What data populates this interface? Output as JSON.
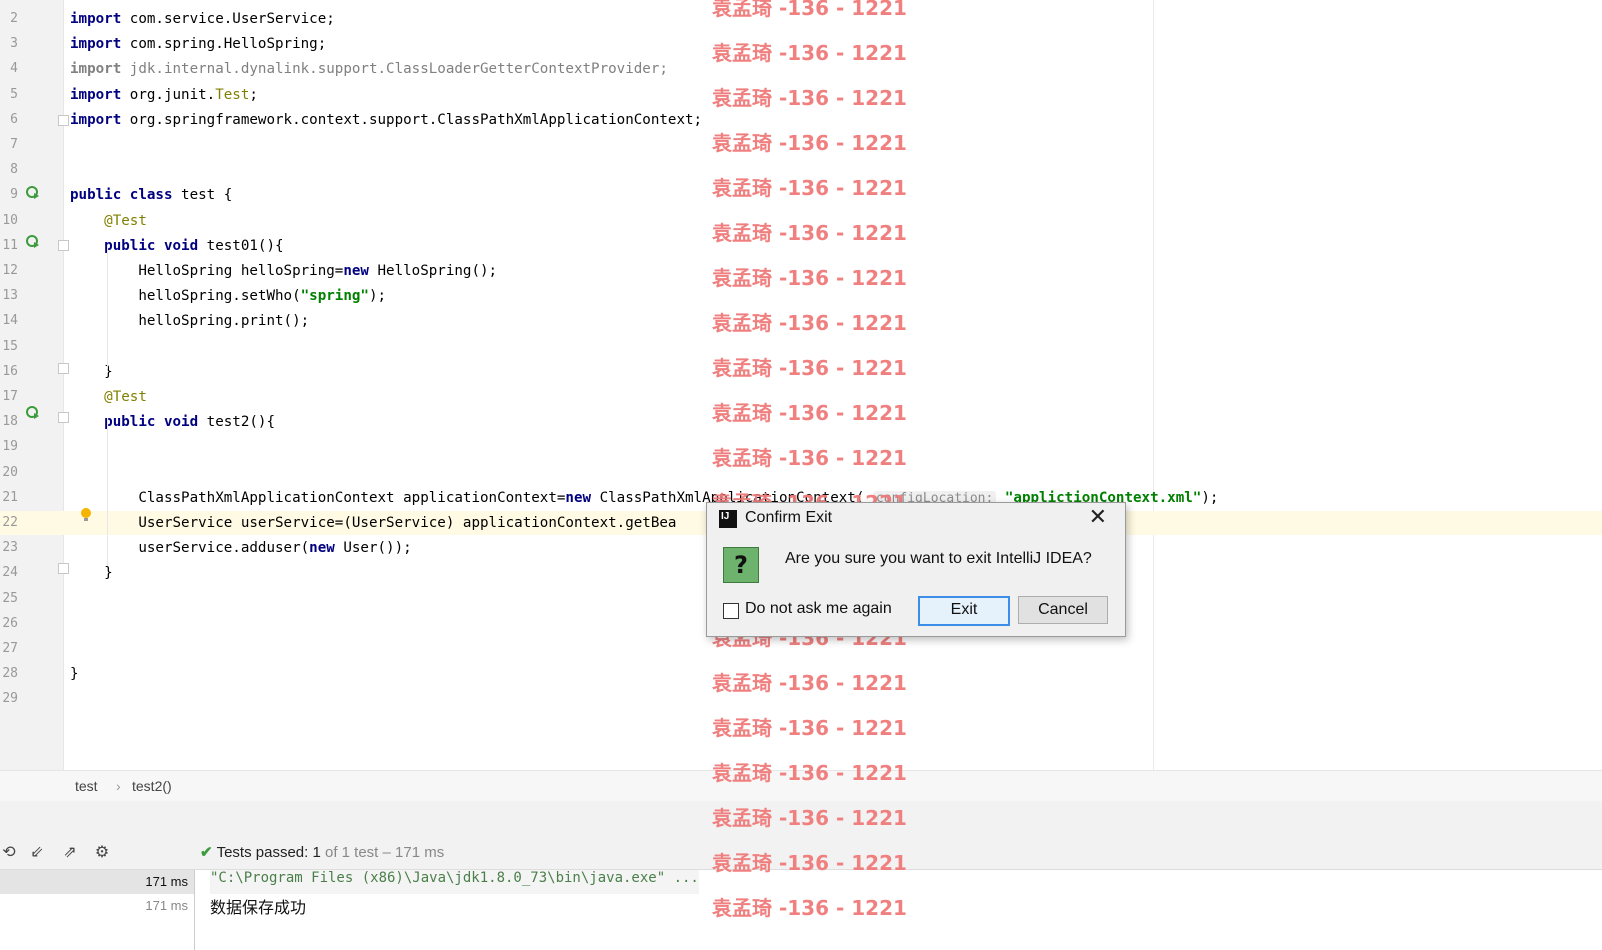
{
  "editor": {
    "lines": [
      {
        "num": "2",
        "html": "<span class=\"kw\">import</span> com.service.UserService;"
      },
      {
        "num": "3",
        "html": "<span class=\"kw\">import</span> com.spring.HelloSpring;"
      },
      {
        "num": "4",
        "html": "<span class=\"kw gray\">import</span> <span class=\"gray\">jdk.internal.dynalink.support.ClassLoaderGetterContextProvider;</span>"
      },
      {
        "num": "5",
        "html": "<span class=\"kw\">import</span> org.junit.<span class=\"ann\">Test</span>;"
      },
      {
        "num": "6",
        "html": "<span class=\"kw\">import</span> org.springframework.context.support.ClassPathXmlApplicationContext;"
      },
      {
        "num": "7",
        "html": ""
      },
      {
        "num": "8",
        "html": ""
      },
      {
        "num": "9",
        "html": "<span class=\"kw\">public class</span> test {"
      },
      {
        "num": "10",
        "html": "    <span class=\"ann\">@Test</span>"
      },
      {
        "num": "11",
        "html": "    <span class=\"kw\">public void</span> test01(){"
      },
      {
        "num": "12",
        "html": "        HelloSpring helloSpring=<span class=\"kw\">new</span> HelloSpring();"
      },
      {
        "num": "13",
        "html": "        helloSpring.setWho(<span class=\"str\">\"spring\"</span>);"
      },
      {
        "num": "14",
        "html": "        helloSpring.print();"
      },
      {
        "num": "15",
        "html": ""
      },
      {
        "num": "16",
        "html": "    }"
      },
      {
        "num": "17",
        "html": "    <span class=\"ann\">@Test</span>"
      },
      {
        "num": "18",
        "html": "    <span class=\"kw\">public void</span> test2(){"
      },
      {
        "num": "19",
        "html": ""
      },
      {
        "num": "20",
        "html": ""
      },
      {
        "num": "21",
        "html": "        ClassPathXmlApplicationContext applicationContext=<span class=\"kw\">new</span> ClassPathXmlApplicationContext( <span class=\"hint\">configLocation:</span> <span class=\"str\">\"applictionContext.xml\"</span>);"
      },
      {
        "num": "22",
        "html": "        UserService userService=(UserService) applicationContext.getBea"
      },
      {
        "num": "23",
        "html": "        userService.adduser(<span class=\"kw\">new</span> User());"
      },
      {
        "num": "24",
        "html": "    }"
      },
      {
        "num": "25",
        "html": ""
      },
      {
        "num": "26",
        "html": ""
      },
      {
        "num": "27",
        "html": ""
      },
      {
        "num": "28",
        "html": "}"
      },
      {
        "num": "29",
        "html": ""
      }
    ]
  },
  "breadcrumb": {
    "class_name": "test",
    "separator": "›",
    "method_name": "test2()"
  },
  "run_panel": {
    "status_prefix": "Tests passed:",
    "status_count": "1",
    "status_suffix": "of 1 test – 171 ms",
    "tree_rows": [
      {
        "time": "171 ms",
        "selected": true
      },
      {
        "time": "171 ms",
        "selected": false
      }
    ],
    "console_lines": [
      "\"C:\\Program Files (x86)\\Java\\jdk1.8.0_73\\bin\\java.exe\" ...",
      "数据保存成功"
    ]
  },
  "watermark_text": "袁孟琦 -136 - 1221",
  "dialog": {
    "title": "Confirm Exit",
    "message": "Are you sure you want to exit IntelliJ IDEA?",
    "checkbox_label": "Do not ask me again",
    "exit_label": "Exit",
    "cancel_label": "Cancel",
    "icon_glyph": "?",
    "close_glyph": "✕"
  },
  "colors": {
    "accent": "#3d8ee8",
    "pass": "#3c9b3c",
    "watermark": "#f07a7a"
  }
}
